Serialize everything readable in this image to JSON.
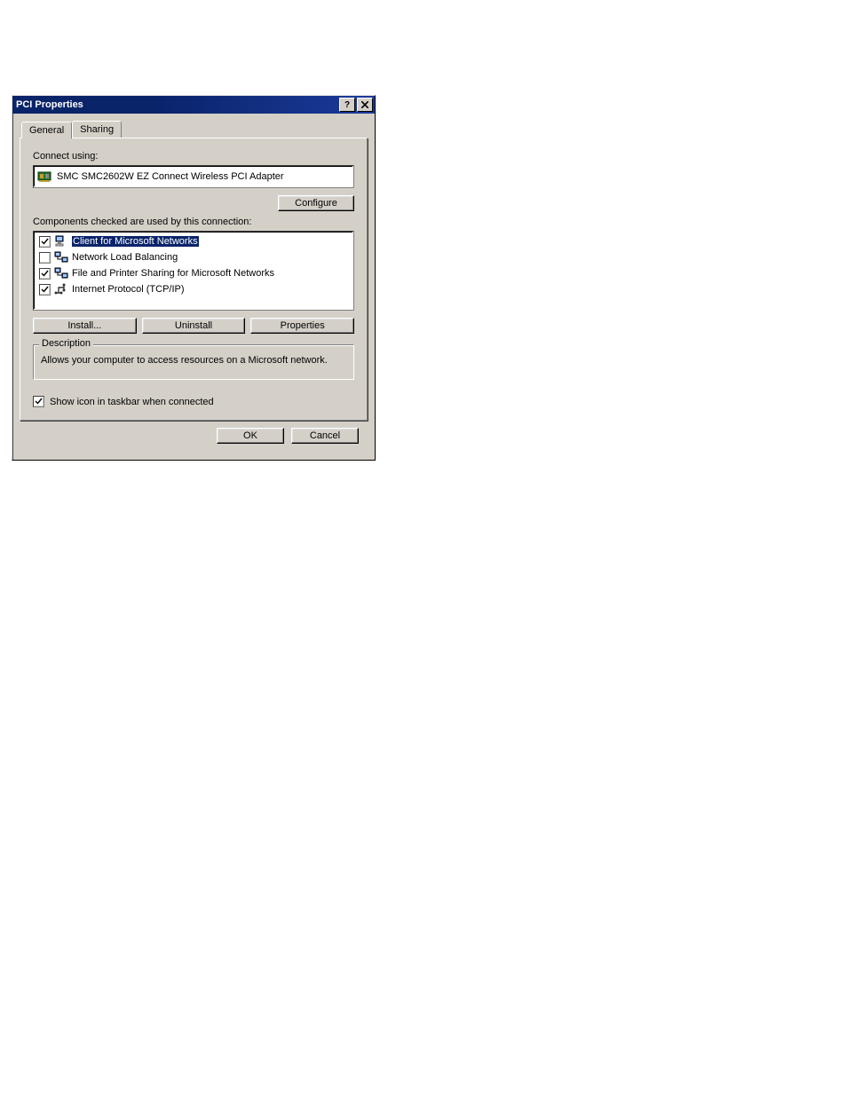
{
  "window": {
    "title": "PCI Properties"
  },
  "tabs": {
    "general": "General",
    "sharing": "Sharing"
  },
  "labels": {
    "connect_using": "Connect using:",
    "components_checked": "Components checked are used by this connection:",
    "show_icon": "Show icon in taskbar when connected"
  },
  "adapter": {
    "name": "SMC SMC2602W EZ Connect Wireless PCI Adapter"
  },
  "buttons": {
    "configure": "Configure",
    "install": "Install...",
    "uninstall": "Uninstall",
    "properties": "Properties",
    "ok": "OK",
    "cancel": "Cancel"
  },
  "components": [
    {
      "label": "Client for Microsoft Networks",
      "checked": true,
      "selected": true,
      "icon": "client"
    },
    {
      "label": "Network Load Balancing",
      "checked": false,
      "selected": false,
      "icon": "service"
    },
    {
      "label": "File and Printer Sharing for Microsoft Networks",
      "checked": true,
      "selected": false,
      "icon": "service"
    },
    {
      "label": "Internet Protocol (TCP/IP)",
      "checked": true,
      "selected": false,
      "icon": "protocol"
    }
  ],
  "description": {
    "legend": "Description",
    "text": "Allows your computer to access resources on a Microsoft network."
  },
  "show_icon_checked": true
}
